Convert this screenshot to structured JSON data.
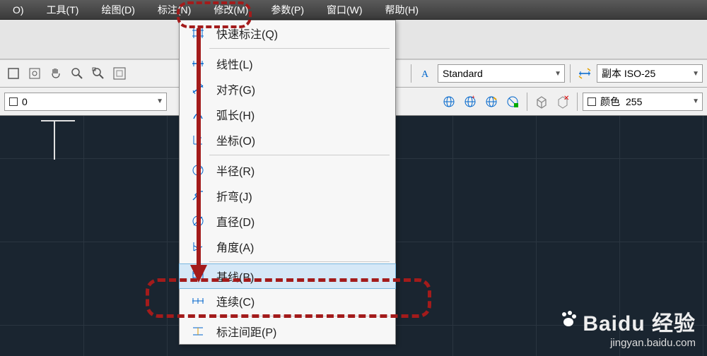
{
  "menubar": {
    "items": [
      {
        "label": "O)"
      },
      {
        "label": "工具(T)"
      },
      {
        "label": "绘图(D)"
      },
      {
        "label": "标注(N)"
      },
      {
        "label": "修改(M)"
      },
      {
        "label": "参数(P)"
      },
      {
        "label": "窗口(W)"
      },
      {
        "label": "帮助(H)"
      }
    ]
  },
  "toolbar1": {
    "style_dropdown": "Standard",
    "dim_style_dropdown": "副本 ISO-25"
  },
  "toolbar2": {
    "layer_name": "0",
    "color_label": "颜色",
    "color_value": "255"
  },
  "dropdown": {
    "items": [
      {
        "icon": "quick-dim-icon",
        "label": "快速标注(Q)"
      },
      {
        "sep": true
      },
      {
        "icon": "linear-dim-icon",
        "label": "线性(L)"
      },
      {
        "icon": "aligned-dim-icon",
        "label": "对齐(G)"
      },
      {
        "icon": "arc-length-icon",
        "label": "弧长(H)"
      },
      {
        "icon": "ordinate-dim-icon",
        "label": "坐标(O)"
      },
      {
        "sep": true
      },
      {
        "icon": "radius-dim-icon",
        "label": "半径(R)"
      },
      {
        "icon": "jogged-dim-icon",
        "label": "折弯(J)"
      },
      {
        "icon": "diameter-dim-icon",
        "label": "直径(D)"
      },
      {
        "icon": "angular-dim-icon",
        "label": "角度(A)"
      },
      {
        "sep": true
      },
      {
        "icon": "baseline-dim-icon",
        "label": "基线(B)",
        "highlighted": true
      },
      {
        "icon": "continue-dim-icon",
        "label": "连续(C)"
      },
      {
        "sep": true
      },
      {
        "icon": "dim-space-icon",
        "label": "标注间距(P)"
      }
    ]
  },
  "watermark": {
    "brand": "Baidu",
    "tag": "经验",
    "url": "jingyan.baidu.com"
  }
}
